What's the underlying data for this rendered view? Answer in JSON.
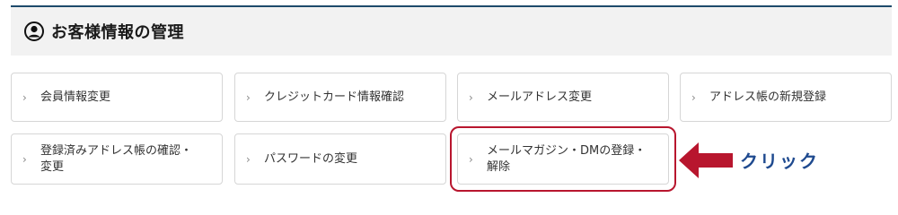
{
  "header": {
    "title": "お客様情報の管理",
    "icon": "user-circle-icon"
  },
  "menu": {
    "items": [
      {
        "label": "会員情報変更"
      },
      {
        "label": "クレジットカード情報確認"
      },
      {
        "label": "メールアドレス変更"
      },
      {
        "label": "アドレス帳の新規登録"
      },
      {
        "label": "登録済みアドレス帳の確認・\n変更"
      },
      {
        "label": "パスワードの変更"
      },
      {
        "label": "メールマガジン・DMの登録・\n解除"
      }
    ]
  },
  "annotation": {
    "click_label": "クリック",
    "accent_color": "#b8162e",
    "text_color": "#1f4a8f"
  }
}
